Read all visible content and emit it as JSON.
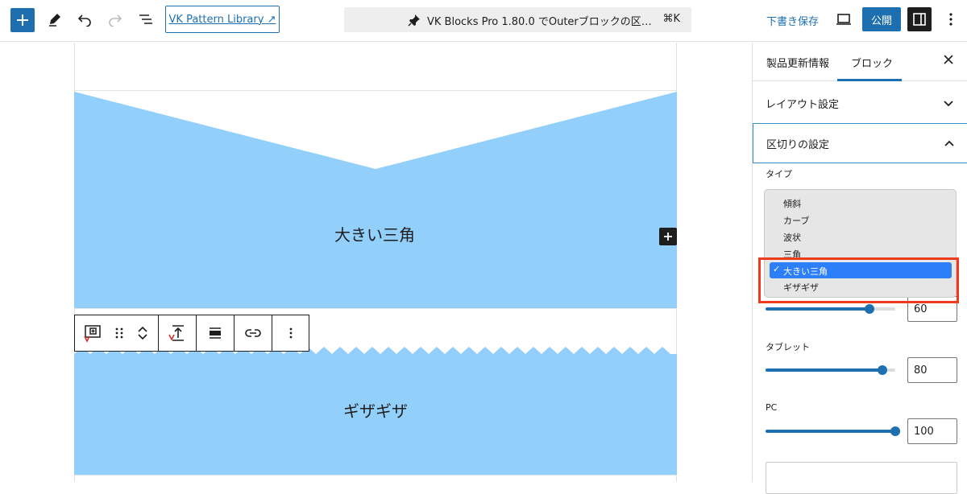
{
  "toolbar": {
    "pattern_library_label": "VK Pattern Library ↗",
    "command_title": "VK Blocks Pro 1.80.0 でOuterブロックの区…",
    "command_shortcut": "⌘K",
    "draft_label": "下書き保存",
    "publish_label": "公開"
  },
  "canvas": {
    "block1_label": "大きい三角",
    "block2_label": "ギザギザ",
    "block_color": "#92cffa"
  },
  "sidebar": {
    "tabs": [
      {
        "label": "製品更新情報"
      },
      {
        "label": "ブロック",
        "active": true
      }
    ],
    "panels": [
      {
        "title": "レイアウト設定",
        "open": false
      },
      {
        "title": "区切りの設定",
        "open": true
      }
    ],
    "type_label": "タイプ",
    "dropdown_options": [
      {
        "label": "傾斜"
      },
      {
        "label": "カーブ"
      },
      {
        "label": "波状"
      },
      {
        "label": "三角"
      },
      {
        "label": "大きい三角",
        "selected": true
      },
      {
        "label": "ギザギザ"
      }
    ],
    "sliders": [
      {
        "label": "",
        "value": "60",
        "fraction": 0.8
      },
      {
        "label": "タブレット",
        "value": "80",
        "fraction": 0.9
      },
      {
        "label": "PC",
        "value": "100",
        "fraction": 1.0
      }
    ]
  },
  "colors": {
    "accent": "#1d6fb0",
    "highlight": "#ee3a1d",
    "selected_option": "#2d7ff9"
  }
}
